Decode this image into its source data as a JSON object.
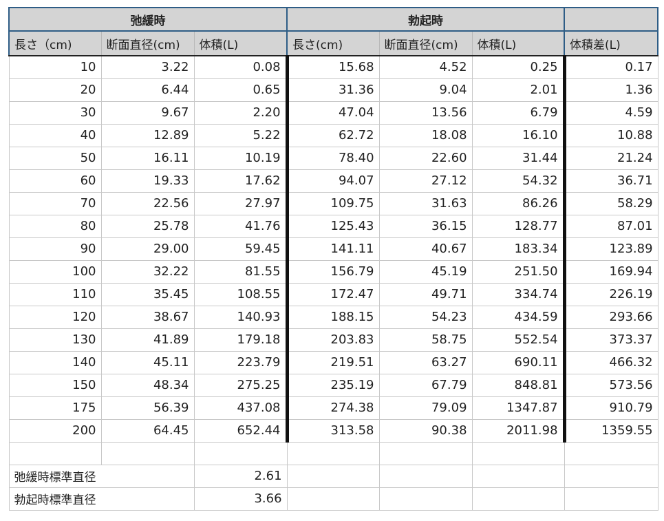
{
  "groups": {
    "flaccid": "弛緩時",
    "erect": "勃起時",
    "diff": ""
  },
  "columns": [
    "長さ（cm)",
    "断面直径(cm)",
    "体積(L)",
    "長さ(cm)",
    "断面直径(cm)",
    "体積(L)",
    "体積差(L)"
  ],
  "rows": [
    [
      "10",
      "3.22",
      "0.08",
      "15.68",
      "4.52",
      "0.25",
      "0.17"
    ],
    [
      "20",
      "6.44",
      "0.65",
      "31.36",
      "9.04",
      "2.01",
      "1.36"
    ],
    [
      "30",
      "9.67",
      "2.20",
      "47.04",
      "13.56",
      "6.79",
      "4.59"
    ],
    [
      "40",
      "12.89",
      "5.22",
      "62.72",
      "18.08",
      "16.10",
      "10.88"
    ],
    [
      "50",
      "16.11",
      "10.19",
      "78.40",
      "22.60",
      "31.44",
      "21.24"
    ],
    [
      "60",
      "19.33",
      "17.62",
      "94.07",
      "27.12",
      "54.32",
      "36.71"
    ],
    [
      "70",
      "22.56",
      "27.97",
      "109.75",
      "31.63",
      "86.26",
      "58.29"
    ],
    [
      "80",
      "25.78",
      "41.76",
      "125.43",
      "36.15",
      "128.77",
      "87.01"
    ],
    [
      "90",
      "29.00",
      "59.45",
      "141.11",
      "40.67",
      "183.34",
      "123.89"
    ],
    [
      "100",
      "32.22",
      "81.55",
      "156.79",
      "45.19",
      "251.50",
      "169.94"
    ],
    [
      "110",
      "35.45",
      "108.55",
      "172.47",
      "49.71",
      "334.74",
      "226.19"
    ],
    [
      "120",
      "38.67",
      "140.93",
      "188.15",
      "54.23",
      "434.59",
      "293.66"
    ],
    [
      "130",
      "41.89",
      "179.18",
      "203.83",
      "58.75",
      "552.54",
      "373.37"
    ],
    [
      "140",
      "45.11",
      "223.79",
      "219.51",
      "63.27",
      "690.11",
      "466.32"
    ],
    [
      "150",
      "48.34",
      "275.25",
      "235.19",
      "67.79",
      "848.81",
      "573.56"
    ],
    [
      "175",
      "56.39",
      "437.08",
      "274.38",
      "79.09",
      "1347.87",
      "910.79"
    ],
    [
      "200",
      "64.45",
      "652.44",
      "313.58",
      "90.38",
      "2011.98",
      "1359.55"
    ]
  ],
  "stats": [
    {
      "label": "弛緩時標準直径",
      "value": "2.61"
    },
    {
      "label": "勃起時標準直径",
      "value": "3.66"
    }
  ]
}
